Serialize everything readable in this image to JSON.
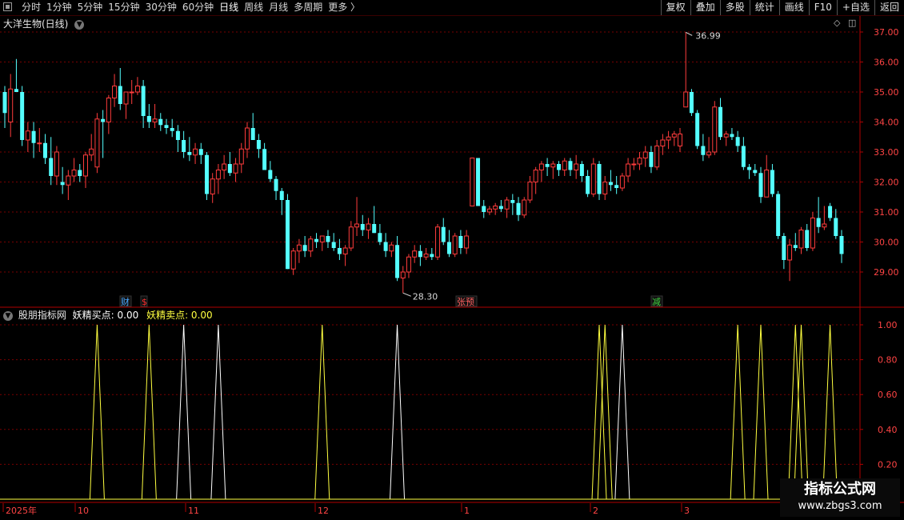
{
  "toolbar": {
    "periods": [
      "分时",
      "1分钟",
      "5分钟",
      "15分钟",
      "30分钟",
      "60分钟",
      "日线",
      "周线",
      "月线",
      "多周期"
    ],
    "more_label": "更多 〉",
    "active_period": "日线",
    "tools": [
      "复权",
      "叠加",
      "多股",
      "统计",
      "画线",
      "F10",
      "+自选",
      "返回"
    ]
  },
  "stock": {
    "title": "大洋生物(日线)"
  },
  "price_panel": {
    "y_ticks": [
      "37.00",
      "36.00",
      "35.00",
      "34.00",
      "33.00",
      "32.00",
      "31.00",
      "30.00",
      "29.00"
    ],
    "high_label": "36.99",
    "low_label": "28.30",
    "event_labels": [
      {
        "text": "财",
        "color": "#4aa8ff"
      },
      {
        "text": "$",
        "color": "#ff3030"
      },
      {
        "text": "张预",
        "color": "#ff6060"
      },
      {
        "text": "减",
        "color": "#40d040"
      }
    ]
  },
  "indicator_panel": {
    "name": "股朋指标网",
    "line1_label": "妖精买点: 0.00",
    "line2_label": "妖精卖点: 0.00",
    "y_ticks": [
      "1.00",
      "0.80",
      "0.60",
      "0.40",
      "0.20"
    ]
  },
  "x_axis": {
    "labels": [
      "2025年",
      "10",
      "11",
      "12",
      "1",
      "2",
      "3"
    ]
  },
  "watermark": {
    "line1": "指标公式网",
    "line2": "www.zbgs3.com"
  },
  "colors": {
    "up": "#ff3c3c",
    "down": "#54ffff",
    "grid": "#7a0000",
    "axis": "#b00000",
    "buy_line": "#ffffff",
    "sell_line": "#ffff40"
  },
  "chart_data": {
    "type": "candlestick",
    "ylim": [
      28.7,
      37.3
    ],
    "ohlc": [
      [
        35.0,
        35.2,
        33.8,
        34.3
      ],
      [
        34.0,
        35.6,
        33.5,
        35.1
      ],
      [
        35.1,
        36.1,
        35.0,
        35.0
      ],
      [
        35.0,
        35.2,
        33.2,
        33.4
      ],
      [
        33.4,
        34.0,
        33.0,
        33.7
      ],
      [
        33.7,
        34.0,
        32.8,
        33.3
      ],
      [
        33.3,
        33.8,
        33.0,
        33.3
      ],
      [
        33.3,
        33.6,
        32.6,
        32.8
      ],
      [
        32.8,
        33.5,
        31.9,
        32.2
      ],
      [
        32.2,
        33.2,
        31.9,
        33.0
      ],
      [
        32.0,
        32.5,
        31.6,
        31.9
      ],
      [
        31.9,
        32.4,
        31.4,
        32.2
      ],
      [
        32.2,
        32.8,
        32.0,
        32.4
      ],
      [
        32.4,
        32.6,
        32.0,
        32.2
      ],
      [
        32.2,
        33.0,
        31.8,
        32.9
      ],
      [
        32.9,
        33.6,
        32.7,
        33.1
      ],
      [
        32.5,
        34.3,
        32.3,
        34.1
      ],
      [
        34.1,
        34.4,
        32.8,
        34.0
      ],
      [
        34.0,
        34.9,
        33.6,
        34.8
      ],
      [
        34.8,
        35.6,
        34.5,
        35.2
      ],
      [
        35.2,
        35.8,
        34.4,
        34.6
      ],
      [
        34.6,
        35.0,
        34.1,
        35.0
      ],
      [
        35.0,
        35.4,
        34.6,
        35.0
      ],
      [
        35.0,
        35.5,
        34.9,
        35.2
      ],
      [
        35.2,
        35.4,
        33.8,
        34.2
      ],
      [
        34.2,
        34.6,
        33.8,
        34.0
      ],
      [
        34.0,
        34.6,
        33.8,
        34.1
      ],
      [
        34.1,
        34.3,
        33.7,
        33.9
      ],
      [
        33.9,
        34.1,
        33.6,
        33.8
      ],
      [
        33.8,
        34.1,
        33.5,
        33.7
      ],
      [
        33.7,
        33.9,
        33.0,
        33.4
      ],
      [
        33.4,
        33.7,
        32.8,
        33.0
      ],
      [
        33.0,
        33.5,
        32.7,
        32.9
      ],
      [
        32.9,
        33.3,
        32.6,
        33.1
      ],
      [
        33.1,
        33.3,
        32.6,
        32.9
      ],
      [
        32.9,
        33.0,
        31.4,
        31.6
      ],
      [
        31.6,
        32.3,
        31.3,
        32.1
      ],
      [
        32.1,
        32.6,
        31.6,
        32.4
      ],
      [
        32.4,
        32.9,
        32.1,
        32.6
      ],
      [
        32.6,
        33.0,
        32.2,
        32.3
      ],
      [
        32.3,
        32.8,
        32.0,
        32.6
      ],
      [
        32.6,
        33.3,
        32.3,
        33.1
      ],
      [
        33.1,
        34.0,
        32.8,
        33.8
      ],
      [
        33.8,
        34.3,
        33.4,
        33.4
      ],
      [
        33.4,
        33.6,
        32.8,
        33.1
      ],
      [
        33.1,
        33.3,
        32.4,
        32.4
      ],
      [
        32.4,
        32.7,
        32.0,
        32.1
      ],
      [
        32.1,
        32.2,
        31.4,
        31.7
      ],
      [
        31.7,
        31.8,
        30.9,
        31.4
      ],
      [
        31.4,
        31.6,
        29.1,
        29.1
      ],
      [
        29.1,
        29.8,
        28.9,
        29.7
      ],
      [
        29.7,
        30.1,
        29.3,
        29.9
      ],
      [
        29.9,
        30.2,
        29.5,
        29.7
      ],
      [
        29.7,
        30.2,
        29.5,
        30.1
      ],
      [
        30.1,
        30.3,
        29.8,
        30.0
      ],
      [
        30.0,
        30.2,
        29.7,
        30.2
      ],
      [
        30.2,
        30.4,
        29.8,
        30.0
      ],
      [
        30.0,
        30.3,
        29.7,
        29.8
      ],
      [
        29.8,
        30.1,
        29.4,
        29.6
      ],
      [
        29.6,
        29.9,
        29.2,
        29.8
      ],
      [
        29.8,
        30.7,
        29.7,
        30.5
      ],
      [
        30.5,
        31.5,
        30.2,
        30.6
      ],
      [
        30.6,
        30.9,
        30.2,
        30.4
      ],
      [
        30.4,
        30.8,
        30.1,
        30.6
      ],
      [
        30.6,
        31.2,
        30.3,
        30.3
      ],
      [
        30.3,
        30.6,
        29.9,
        30.0
      ],
      [
        30.0,
        30.3,
        29.5,
        29.7
      ],
      [
        29.7,
        30.0,
        29.5,
        29.9
      ],
      [
        29.9,
        30.2,
        28.7,
        28.8
      ],
      [
        28.8,
        29.2,
        28.3,
        29.0
      ],
      [
        29.0,
        29.6,
        28.8,
        29.5
      ],
      [
        29.5,
        29.9,
        29.3,
        29.7
      ],
      [
        29.7,
        29.9,
        29.2,
        29.5
      ],
      [
        29.5,
        29.8,
        29.4,
        29.6
      ],
      [
        29.6,
        29.8,
        29.4,
        29.5
      ],
      [
        29.5,
        30.6,
        29.4,
        30.5
      ],
      [
        30.5,
        30.8,
        29.9,
        30.0
      ],
      [
        30.0,
        30.4,
        29.5,
        29.6
      ],
      [
        29.6,
        30.3,
        29.5,
        30.2
      ],
      [
        30.2,
        30.4,
        29.6,
        29.8
      ],
      [
        29.8,
        30.4,
        29.6,
        30.2
      ],
      [
        31.2,
        32.8,
        31.2,
        32.8
      ],
      [
        32.8,
        32.8,
        31.2,
        31.2
      ],
      [
        31.2,
        31.4,
        30.8,
        31.0
      ],
      [
        31.0,
        31.2,
        30.9,
        31.1
      ],
      [
        31.1,
        31.3,
        30.9,
        31.2
      ],
      [
        31.2,
        31.4,
        31.0,
        31.1
      ],
      [
        31.1,
        31.5,
        30.8,
        31.4
      ],
      [
        31.4,
        31.6,
        30.9,
        31.3
      ],
      [
        31.3,
        31.5,
        30.7,
        30.9
      ],
      [
        30.9,
        31.5,
        30.8,
        31.4
      ],
      [
        31.4,
        32.2,
        31.3,
        32.0
      ],
      [
        32.0,
        32.5,
        31.6,
        32.4
      ],
      [
        32.4,
        32.7,
        32.0,
        32.6
      ],
      [
        32.6,
        32.8,
        32.2,
        32.5
      ],
      [
        32.5,
        32.7,
        32.1,
        32.6
      ],
      [
        32.6,
        32.7,
        32.2,
        32.4
      ],
      [
        32.4,
        32.8,
        32.2,
        32.7
      ],
      [
        32.7,
        32.8,
        32.2,
        32.4
      ],
      [
        32.4,
        32.9,
        32.1,
        32.6
      ],
      [
        32.6,
        32.7,
        32.0,
        32.2
      ],
      [
        32.2,
        32.4,
        31.5,
        31.6
      ],
      [
        31.6,
        32.8,
        31.5,
        32.6
      ],
      [
        32.6,
        32.7,
        31.4,
        31.6
      ],
      [
        31.6,
        32.2,
        31.4,
        32.0
      ],
      [
        32.0,
        32.4,
        31.7,
        31.9
      ],
      [
        31.9,
        32.2,
        31.6,
        31.8
      ],
      [
        31.8,
        32.3,
        31.7,
        32.2
      ],
      [
        32.2,
        32.8,
        32.0,
        32.6
      ],
      [
        32.6,
        32.8,
        32.4,
        32.6
      ],
      [
        32.6,
        33.0,
        32.4,
        32.8
      ],
      [
        32.8,
        33.2,
        32.5,
        33.0
      ],
      [
        33.0,
        33.2,
        32.3,
        32.5
      ],
      [
        32.5,
        33.4,
        32.4,
        33.2
      ],
      [
        33.2,
        33.6,
        32.9,
        33.4
      ],
      [
        33.4,
        33.7,
        33.1,
        33.5
      ],
      [
        33.5,
        33.7,
        33.2,
        33.6
      ],
      [
        33.2,
        33.8,
        33.0,
        33.6
      ],
      [
        34.5,
        36.99,
        34.5,
        35.0
      ],
      [
        35.0,
        35.1,
        34.2,
        34.3
      ],
      [
        34.3,
        34.4,
        33.1,
        33.2
      ],
      [
        33.2,
        33.6,
        32.7,
        32.9
      ],
      [
        32.9,
        33.5,
        32.8,
        33.0
      ],
      [
        33.0,
        34.7,
        32.9,
        34.5
      ],
      [
        34.5,
        34.8,
        33.4,
        33.5
      ],
      [
        33.5,
        33.7,
        33.2,
        33.6
      ],
      [
        33.6,
        33.8,
        33.4,
        33.5
      ],
      [
        33.5,
        33.7,
        33.0,
        33.2
      ],
      [
        33.2,
        33.5,
        32.4,
        32.5
      ],
      [
        32.5,
        32.6,
        32.1,
        32.4
      ],
      [
        32.4,
        32.6,
        32.2,
        32.3
      ],
      [
        32.3,
        32.5,
        31.3,
        31.5
      ],
      [
        31.5,
        32.9,
        31.5,
        32.4
      ],
      [
        32.4,
        32.6,
        31.5,
        31.6
      ],
      [
        31.6,
        31.7,
        30.1,
        30.2
      ],
      [
        30.2,
        30.3,
        29.1,
        29.4
      ],
      [
        29.4,
        30.1,
        28.7,
        29.9
      ],
      [
        29.9,
        30.3,
        29.7,
        29.8
      ],
      [
        29.8,
        30.5,
        29.6,
        30.4
      ],
      [
        30.4,
        30.6,
        29.7,
        29.8
      ],
      [
        29.8,
        31.0,
        29.7,
        30.8
      ],
      [
        30.8,
        31.5,
        30.3,
        30.5
      ],
      [
        30.5,
        31.2,
        30.4,
        30.6
      ],
      [
        31.2,
        31.3,
        30.7,
        30.8
      ],
      [
        30.8,
        31.1,
        30.1,
        30.2
      ],
      [
        30.2,
        30.4,
        29.3,
        29.6
      ]
    ],
    "indicator": {
      "series": [
        {
          "name": "妖精买点",
          "values_at_index": [
            31,
            37,
            68,
            107
          ]
        },
        {
          "name": "妖精卖点",
          "values_at_index": [
            16,
            25,
            55,
            103,
            104,
            127,
            131,
            137,
            138,
            143
          ]
        }
      ],
      "ylim": [
        0,
        1.0
      ]
    }
  }
}
